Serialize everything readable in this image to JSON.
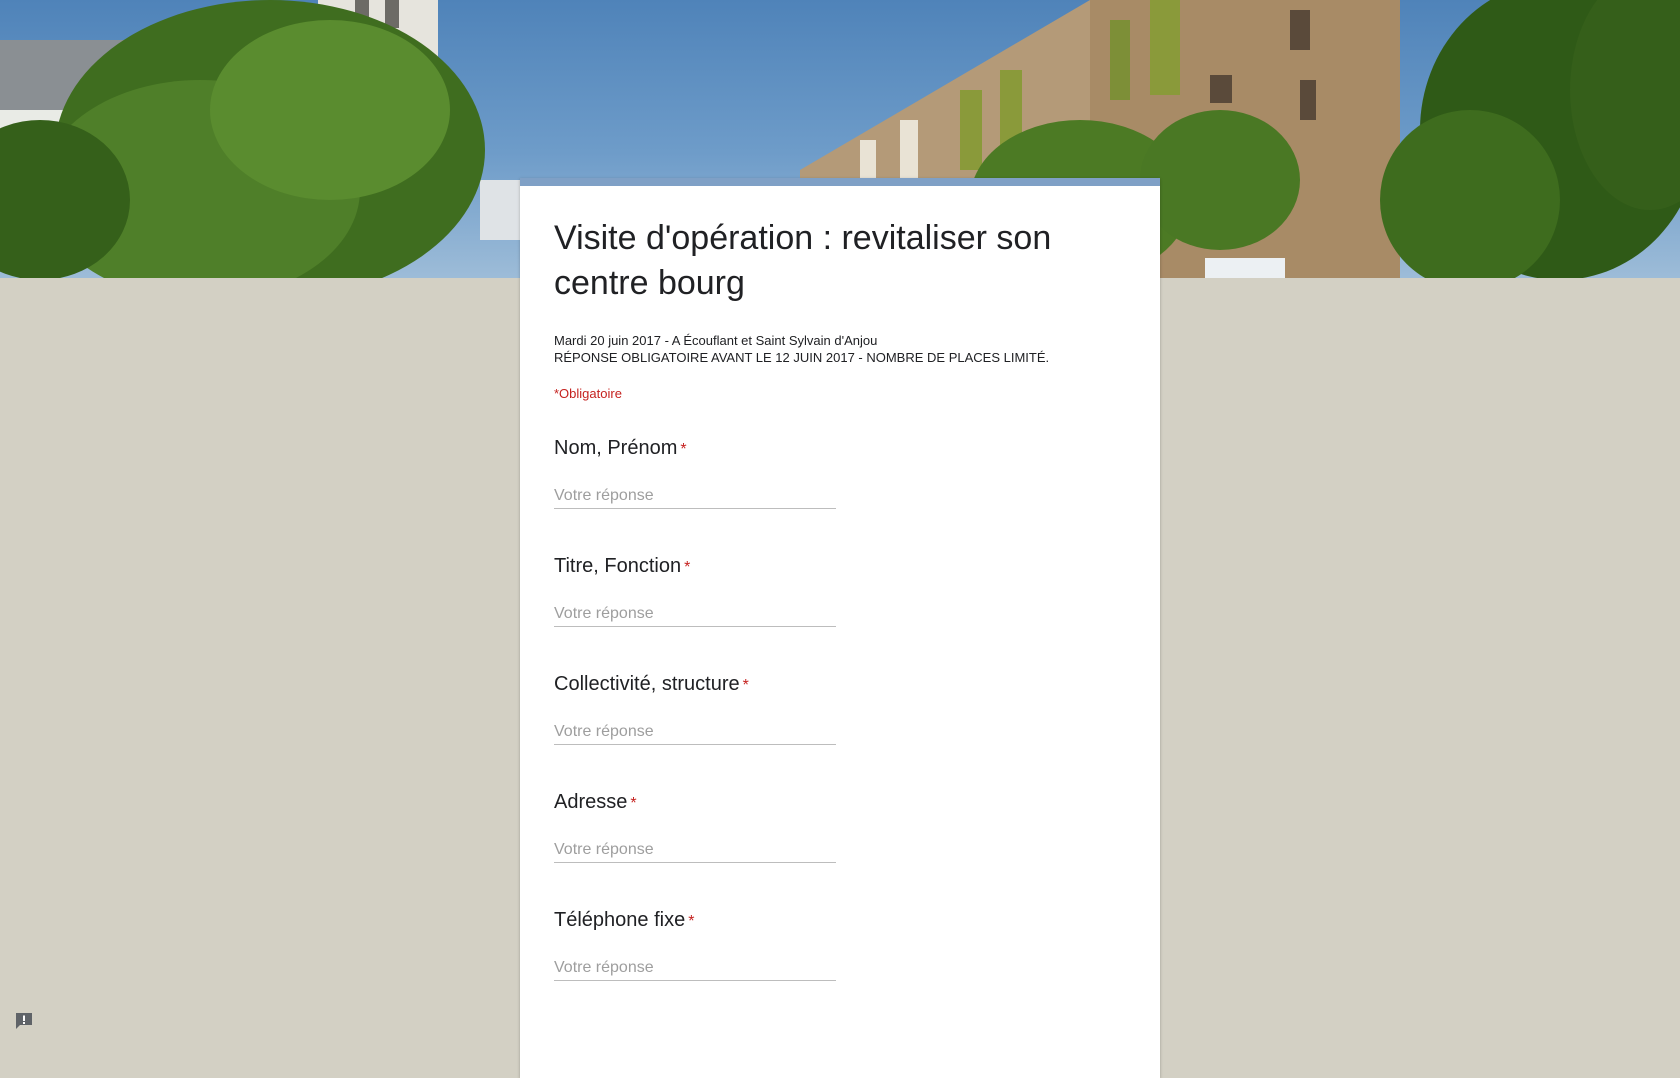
{
  "form": {
    "title": "Visite d'opération : revitaliser son centre bourg",
    "description_lines": [
      "Mardi 20 juin 2017 - A Écouflant et Saint Sylvain d'Anjou",
      "RÉPONSE OBLIGATOIRE AVANT LE 12 JUIN 2017 - NOMBRE DE PLACES LIMITÉ."
    ],
    "required_note": "*Obligatoire",
    "accent_color": "#7fa0c6",
    "background_color": "#d3d0c4"
  },
  "questions": [
    {
      "label": "Nom, Prénom",
      "required_mark": "*",
      "placeholder": "Votre réponse"
    },
    {
      "label": "Titre, Fonction",
      "required_mark": "*",
      "placeholder": "Votre réponse"
    },
    {
      "label": "Collectivité, structure",
      "required_mark": "*",
      "placeholder": "Votre réponse"
    },
    {
      "label": "Adresse",
      "required_mark": "*",
      "placeholder": "Votre réponse"
    },
    {
      "label": "Téléphone fixe",
      "required_mark": "*",
      "placeholder": "Votre réponse"
    }
  ],
  "footer": {
    "feedback_icon": "report-problem-icon"
  }
}
